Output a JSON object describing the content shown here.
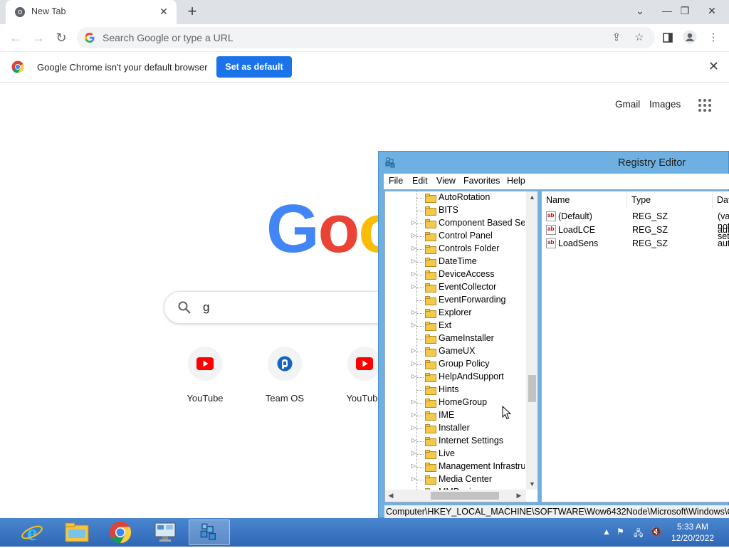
{
  "browser": {
    "tab_title": "New Tab",
    "tab_close": "✕",
    "new_tab": "+",
    "window_controls": {
      "minimize": "⌄",
      "dash": "—",
      "restore": "❐",
      "close": "✕"
    },
    "omnibox_placeholder": "Search Google or type a URL",
    "infobar": {
      "message": "Google Chrome isn't your default browser",
      "button": "Set as default"
    }
  },
  "ntp": {
    "links": {
      "gmail": "Gmail",
      "images": "Images"
    },
    "logo_letters": [
      "G",
      "o",
      "o"
    ],
    "logo_colors": [
      "#4285f4",
      "#ea4335",
      "#fbbc05"
    ],
    "search_query": "g",
    "shortcuts": [
      {
        "label": "YouTube",
        "icon": "youtube-icon"
      },
      {
        "label": "Team OS",
        "icon": "team-os-icon"
      },
      {
        "label": "YouTube",
        "icon": "youtube-icon"
      }
    ]
  },
  "regedit": {
    "title": "Registry Editor",
    "menu": [
      "File",
      "Edit",
      "View",
      "Favorites",
      "Help"
    ],
    "tree_items": [
      {
        "name": "AutoRotation",
        "expandable": false
      },
      {
        "name": "BITS",
        "expandable": false
      },
      {
        "name": "Component Based Servicing",
        "expandable": true
      },
      {
        "name": "Control Panel",
        "expandable": true
      },
      {
        "name": "Controls Folder",
        "expandable": true
      },
      {
        "name": "DateTime",
        "expandable": true
      },
      {
        "name": "DeviceAccess",
        "expandable": true
      },
      {
        "name": "EventCollector",
        "expandable": true
      },
      {
        "name": "EventForwarding",
        "expandable": false
      },
      {
        "name": "Explorer",
        "expandable": true
      },
      {
        "name": "Ext",
        "expandable": true
      },
      {
        "name": "GameInstaller",
        "expandable": false
      },
      {
        "name": "GameUX",
        "expandable": true
      },
      {
        "name": "Group Policy",
        "expandable": true
      },
      {
        "name": "HelpAndSupport",
        "expandable": true
      },
      {
        "name": "Hints",
        "expandable": false
      },
      {
        "name": "HomeGroup",
        "expandable": true
      },
      {
        "name": "IME",
        "expandable": true
      },
      {
        "name": "Installer",
        "expandable": true
      },
      {
        "name": "Internet Settings",
        "expandable": true
      },
      {
        "name": "Live",
        "expandable": true
      },
      {
        "name": "Management Infrastructure",
        "expandable": true
      },
      {
        "name": "Media Center",
        "expandable": true
      },
      {
        "name": "MMDevices",
        "expandable": true
      }
    ],
    "columns": [
      "Name",
      "Type",
      "Data"
    ],
    "values": [
      {
        "name": "(Default)",
        "type": "REG_SZ",
        "data": "(value not set)"
      },
      {
        "name": "LoadLCE",
        "type": "REG_SZ",
        "data": "auto"
      },
      {
        "name": "LoadSens",
        "type": "REG_SZ",
        "data": "auto"
      }
    ],
    "status_path": "Computer\\HKEY_LOCAL_MACHINE\\SOFTWARE\\Wow6432Node\\Microsoft\\Windows\\CurrentVersion"
  },
  "taskbar": {
    "apps": [
      "internet-explorer-icon",
      "file-explorer-icon",
      "chrome-icon",
      "remote-desktop-icon",
      "registry-editor-icon"
    ],
    "active_app": "registry-editor-icon",
    "clock_time": "5:33 AM",
    "clock_date": "12/20/2022"
  },
  "colors": {
    "chrome_blue": "#1a73e8",
    "taskbar": "#3d76c2",
    "regedit_frame": "#6fb0e3"
  }
}
